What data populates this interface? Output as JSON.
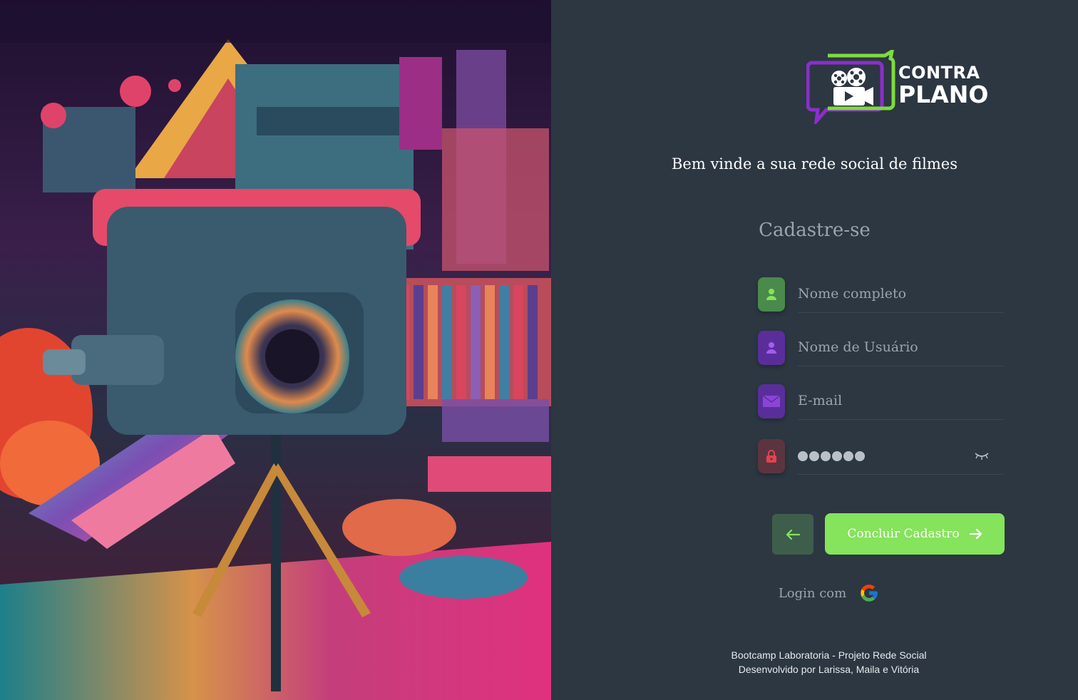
{
  "art": {
    "description_icon": "cinema-camera-artwork"
  },
  "brand": {
    "line1": "CONTRA",
    "line2": "PLANO",
    "icon": "film-camera-chat-icon",
    "colors": {
      "purple": "#8b2fc9",
      "green": "#7ddc3b"
    }
  },
  "welcome": "Bem vinde a sua rede social de filmes",
  "heading": "Cadastre-se",
  "form": {
    "full_name": {
      "placeholder": "Nome completo",
      "icon": "user-icon",
      "color": "#4a8a4a"
    },
    "username": {
      "placeholder": "Nome de Usuário",
      "icon": "user-icon",
      "color": "#5a2e9a"
    },
    "email": {
      "placeholder": "E-mail",
      "icon": "envelope-icon",
      "color": "#5a2e9a"
    },
    "password": {
      "mask": "●●●●●●",
      "icon": "lock-icon",
      "color": "#5a3540",
      "toggle_icon": "eye-closed-icon"
    }
  },
  "buttons": {
    "back_icon": "arrow-left-icon",
    "submit_label": "Concluir Cadastro",
    "submit_icon": "arrow-right-icon"
  },
  "login": {
    "label": "Login com",
    "icon": "google-icon"
  },
  "footer": {
    "line1": "Bootcamp Laboratoria - Projeto Rede Social",
    "line2": "Desenvolvido por Larissa, Maila e Vitória"
  }
}
